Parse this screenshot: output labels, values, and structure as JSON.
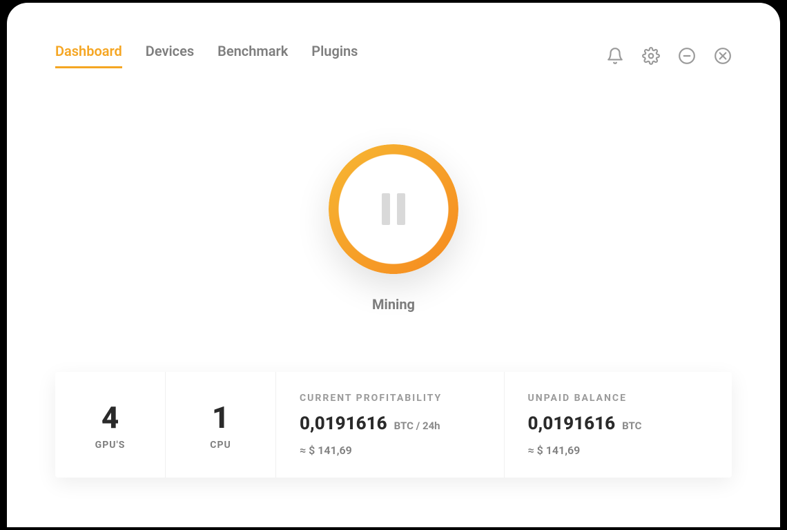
{
  "tabs": {
    "dashboard": "Dashboard",
    "devices": "Devices",
    "benchmark": "Benchmark",
    "plugins": "Plugins",
    "active": "dashboard"
  },
  "status": {
    "label": "Mining",
    "state": "running"
  },
  "devices": {
    "gpu_count": "4",
    "gpu_label": "GPU'S",
    "cpu_count": "1",
    "cpu_label": "CPU"
  },
  "profitability": {
    "heading": "CURRENT PROFITABILITY",
    "value": "0,0191616",
    "unit": "BTC  / 24h",
    "approx": "≈ $ 141,69"
  },
  "balance": {
    "heading": "UNPAID BALANCE",
    "value": "0,0191616",
    "unit": "BTC",
    "approx": "≈ $ 141,69"
  },
  "icons": {
    "notifications": "bell-icon",
    "settings": "gear-icon",
    "minimize": "minimize-circle-icon",
    "close": "close-circle-icon"
  },
  "colors": {
    "accent": "#f5a623",
    "text_muted": "#7e7e7e"
  }
}
